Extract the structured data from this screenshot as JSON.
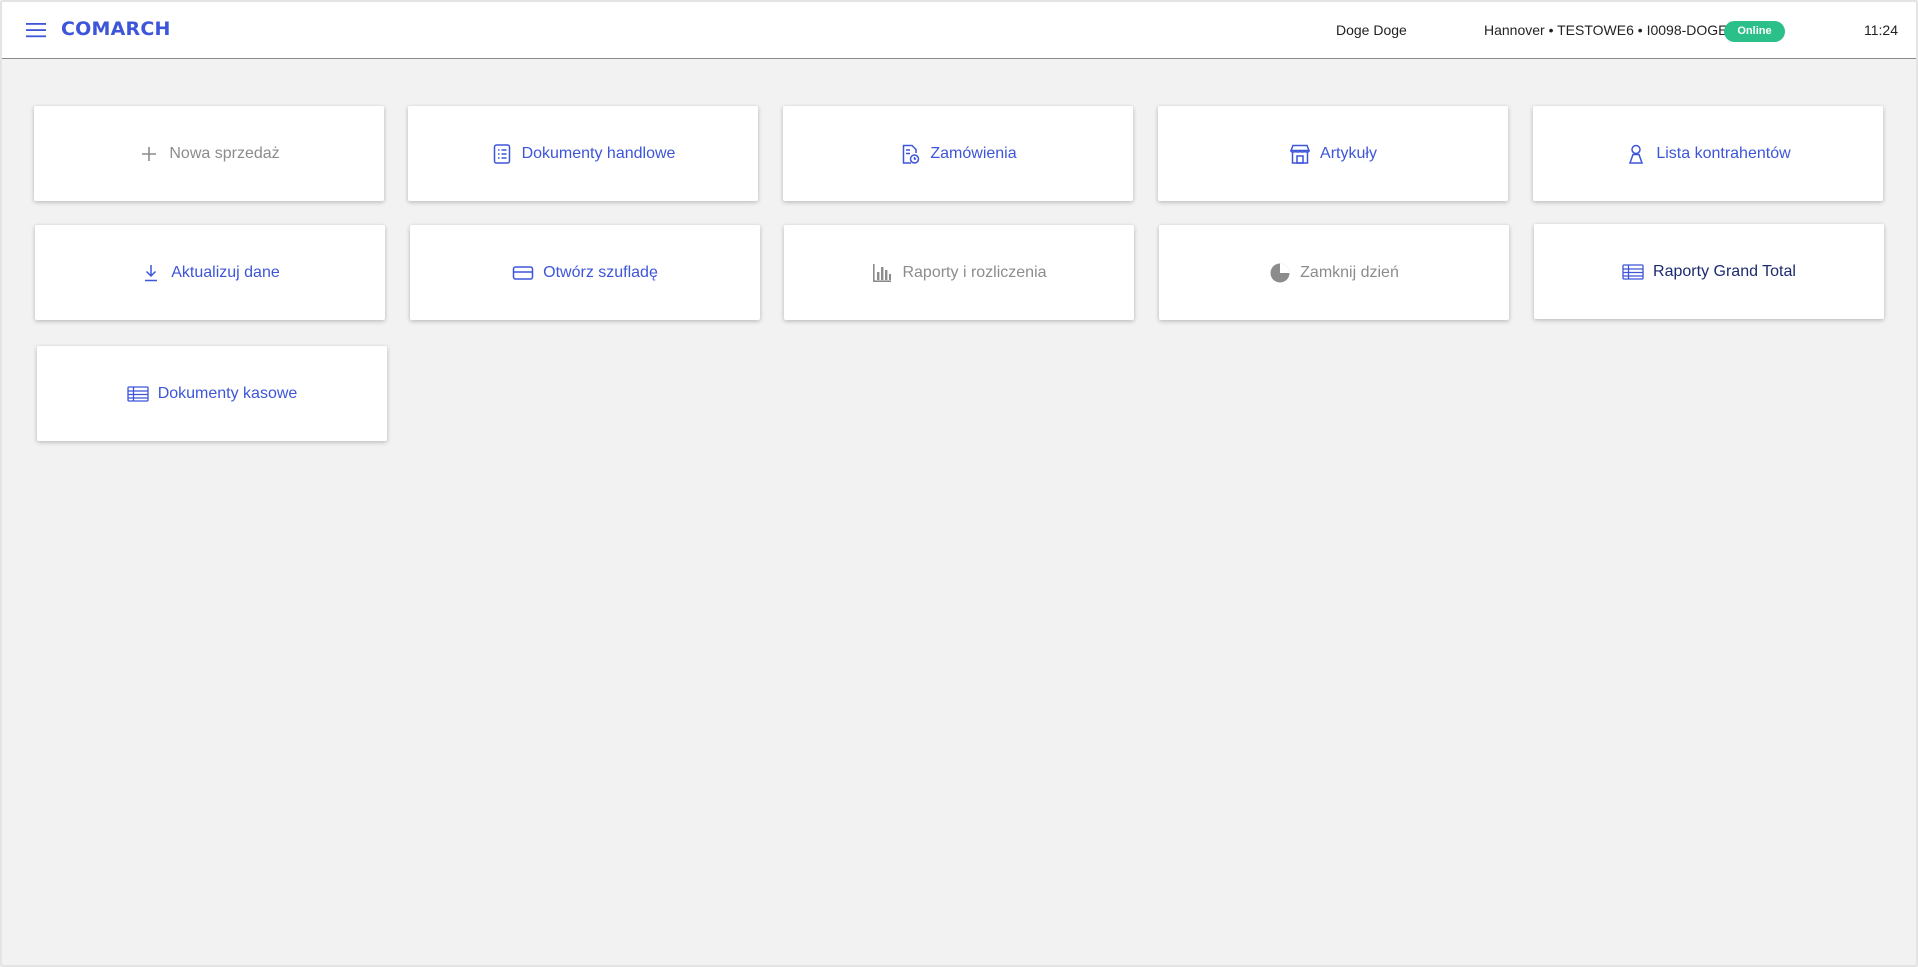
{
  "header": {
    "logo": "COMARCH",
    "user": "Doge Doge",
    "location": "Hannover • TESTOWE6 • I0098-DOGE",
    "status": "Online",
    "time": "11:24",
    "menu_icon": "hamburger-menu-icon"
  },
  "colors": {
    "accent": "#3d55d9",
    "disabled": "#8c8c8c",
    "dark": "#1c2a6e",
    "online": "#2bbf8a",
    "background": "#f2f2f2"
  },
  "tiles": [
    {
      "label": "Nowa sprzedaż",
      "icon": "plus-icon",
      "state": "disabled"
    },
    {
      "label": "Dokumenty handlowe",
      "icon": "document-list-icon",
      "state": "active"
    },
    {
      "label": "Zamówienia",
      "icon": "order-icon",
      "state": "active"
    },
    {
      "label": "Artykuły",
      "icon": "store-icon",
      "state": "active"
    },
    {
      "label": "Lista kontrahentów",
      "icon": "person-icon",
      "state": "active"
    },
    {
      "label": "Aktualizuj dane",
      "icon": "download-icon",
      "state": "active"
    },
    {
      "label": "Otwórz szufladę",
      "icon": "card-icon",
      "state": "active"
    },
    {
      "label": "Raporty i rozliczenia",
      "icon": "bar-chart-icon",
      "state": "disabled"
    },
    {
      "label": "Zamknij dzień",
      "icon": "pie-icon",
      "state": "disabled"
    },
    {
      "label": "Raporty Grand Total",
      "icon": "table-icon",
      "state": "dark"
    },
    {
      "label": "Dokumenty kasowe",
      "icon": "table-icon",
      "state": "active"
    }
  ]
}
